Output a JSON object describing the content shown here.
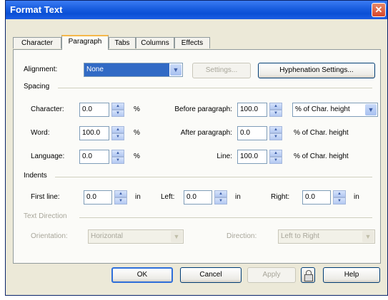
{
  "window": {
    "title": "Format Text",
    "close_glyph": "✕"
  },
  "tabs": [
    {
      "label": "Character",
      "active": false
    },
    {
      "label": "Paragraph",
      "active": true
    },
    {
      "label": "Tabs",
      "active": false
    },
    {
      "label": "Columns",
      "active": false
    },
    {
      "label": "Effects",
      "active": false
    }
  ],
  "alignment": {
    "label": "Alignment:",
    "value": "None",
    "settings_label": "Settings...",
    "hyphenation_label": "Hyphenation Settings..."
  },
  "spacing": {
    "group_label": "Spacing",
    "character": {
      "label": "Character:",
      "value": "0.0",
      "unit": "%"
    },
    "word": {
      "label": "Word:",
      "value": "100.0",
      "unit": "%"
    },
    "language": {
      "label": "Language:",
      "value": "0.0",
      "unit": "%"
    },
    "before_paragraph": {
      "label": "Before paragraph:",
      "value": "100.0",
      "unit_selected": "% of Char. height"
    },
    "after_paragraph": {
      "label": "After paragraph:",
      "value": "0.0",
      "unit": "% of Char. height"
    },
    "line": {
      "label": "Line:",
      "value": "100.0",
      "unit": "% of Char. height"
    }
  },
  "indents": {
    "group_label": "Indents",
    "first_line": {
      "label": "First line:",
      "value": "0.0",
      "unit": "in"
    },
    "left": {
      "label": "Left:",
      "value": "0.0",
      "unit": "in"
    },
    "right": {
      "label": "Right:",
      "value": "0.0",
      "unit": "in"
    }
  },
  "text_direction": {
    "group_label": "Text Direction",
    "orientation": {
      "label": "Orientation:",
      "value": "Horizontal"
    },
    "direction": {
      "label": "Direction:",
      "value": "Left to Right"
    }
  },
  "buttons": {
    "ok": "OK",
    "cancel": "Cancel",
    "apply": "Apply",
    "help": "Help"
  },
  "icons": {
    "dropdown": "▼",
    "spin_up": "▲",
    "spin_down": "▼"
  },
  "colors": {
    "titlebar": "#0a4fd6",
    "selection": "#316ac5",
    "active_tab_accent": "#f5b74a",
    "dialog_bg": "#ece9d8"
  }
}
